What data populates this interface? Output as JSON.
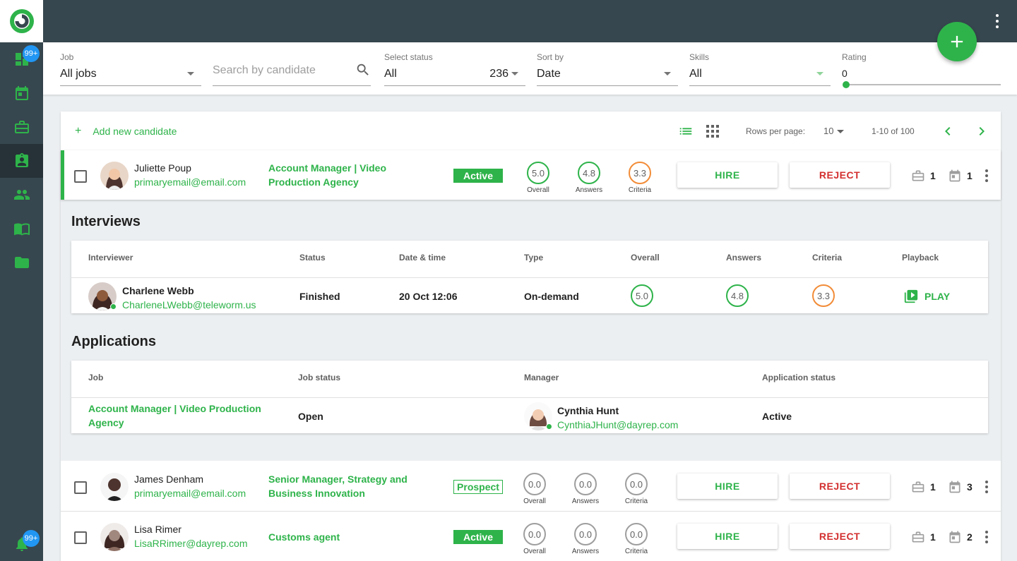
{
  "sidebar": {
    "badges": {
      "dashboard": "99+",
      "notifications": "99+"
    },
    "items": [
      "dashboard-icon",
      "calendar-icon",
      "briefcase-icon",
      "candidates-icon",
      "people-icon",
      "book-icon",
      "folder-icon",
      "bell-icon"
    ]
  },
  "filters": {
    "job": {
      "label": "Job",
      "value": "All jobs"
    },
    "search": {
      "placeholder": "Search by candidate"
    },
    "status": {
      "label": "Select status",
      "value": "All",
      "count": "236"
    },
    "sort": {
      "label": "Sort by",
      "value": "Date"
    },
    "skills": {
      "label": "Skills",
      "value": "All"
    },
    "rating": {
      "label": "Rating",
      "value": "0"
    }
  },
  "toolbar": {
    "add_new": "Add new candidate",
    "rows_per_page_label": "Rows per page:",
    "rows_per_page": "10",
    "range": "1-10 of 100"
  },
  "score_labels": {
    "overall": "Overall",
    "answers": "Answers",
    "criteria": "Criteria"
  },
  "buttons": {
    "hire": "HIRE",
    "reject": "REJECT"
  },
  "candidates": [
    {
      "name": "Juliette Poup",
      "email": "primaryemail@email.com",
      "job": "Account Manager | Video Production Agency",
      "status": "Active",
      "overall": "5.0",
      "answers": "4.8",
      "criteria": "3.3",
      "jobs_count": "1",
      "events_count": "1"
    },
    {
      "name": "James Denham",
      "email": "primaryemail@email.com",
      "job": "Senior Manager, Strategy and Business Innovation",
      "status": "Prospect",
      "overall": "0.0",
      "answers": "0.0",
      "criteria": "0.0",
      "jobs_count": "1",
      "events_count": "3"
    },
    {
      "name": "Lisa Rimer",
      "email": "LisaRRimer@dayrep.com",
      "job": "Customs agent",
      "status": "Active",
      "overall": "0.0",
      "answers": "0.0",
      "criteria": "0.0",
      "jobs_count": "1",
      "events_count": "2"
    }
  ],
  "interviews": {
    "title": "Interviews",
    "headers": [
      "Interviewer",
      "Status",
      "Date & time",
      "Type",
      "Overall",
      "Answers",
      "Criteria",
      "Playback"
    ],
    "rows": [
      {
        "name": "Charlene Webb",
        "email": "CharleneLWebb@teleworm.us",
        "status": "Finished",
        "datetime": "20 Oct 12:06",
        "type": "On-demand",
        "overall": "5.0",
        "answers": "4.8",
        "criteria": "3.3",
        "playback": "PLAY"
      }
    ]
  },
  "applications": {
    "title": "Applications",
    "headers": [
      "Job",
      "Job status",
      "Manager",
      "Application status"
    ],
    "rows": [
      {
        "job": "Account Manager | Video Production Agency",
        "job_status": "Open",
        "manager_name": "Cynthia Hunt",
        "manager_email": "CynthiaJHunt@dayrep.com",
        "app_status": "Active"
      }
    ]
  },
  "colors": {
    "accent": "#2eb34a",
    "reject": "#d32f2f",
    "orange": "#f28c38",
    "sidebar": "#37474f"
  }
}
